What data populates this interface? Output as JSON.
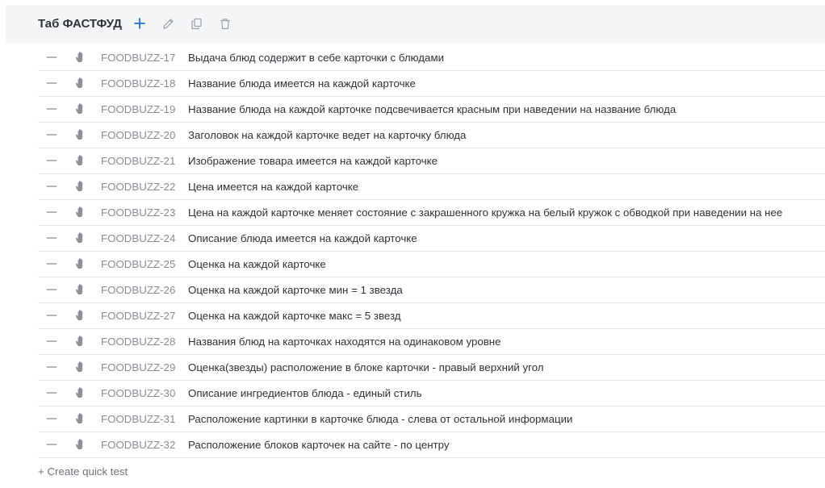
{
  "suite": {
    "title": "Таб ФАСТФУД",
    "actions": {
      "add": "plus-icon",
      "edit": "pencil-icon",
      "copy": "copy-icon",
      "delete": "trash-icon"
    }
  },
  "colors": {
    "accent": "#1d6fe0",
    "header_bg": "#f4f5f7",
    "icon_gray": "#9aa0a8",
    "row_border": "#e4e6ea"
  },
  "cases": [
    {
      "id": "FOODBUZZ-17",
      "title": "Выдача блюд содержит в себе карточки с блюдами"
    },
    {
      "id": "FOODBUZZ-18",
      "title": "Название блюда имеется на каждой карточке"
    },
    {
      "id": "FOODBUZZ-19",
      "title": "Название блюда на каждой карточке подсвечивается красным при наведении на название блюда"
    },
    {
      "id": "FOODBUZZ-20",
      "title": "Заголовок на каждой карточке ведет на карточку блюда"
    },
    {
      "id": "FOODBUZZ-21",
      "title": "Изображение товара имеется на каждой карточке"
    },
    {
      "id": "FOODBUZZ-22",
      "title": "Цена имеется на каждой карточке"
    },
    {
      "id": "FOODBUZZ-23",
      "title": "Цена на каждой карточке меняет состояние с закрашенного кружка на белый кружок с обводкой при наведении на нее"
    },
    {
      "id": "FOODBUZZ-24",
      "title": "Описание блюда имеется на каждой карточке"
    },
    {
      "id": "FOODBUZZ-25",
      "title": "Оценка на каждой карточке"
    },
    {
      "id": "FOODBUZZ-26",
      "title": "Оценка на каждой карточке мин = 1 звезда"
    },
    {
      "id": "FOODBUZZ-27",
      "title": "Оценка на каждой карточке макс = 5 звезд"
    },
    {
      "id": "FOODBUZZ-28",
      "title": "Названия блюд на карточках находятся на одинаковом уровне"
    },
    {
      "id": "FOODBUZZ-29",
      "title": "Оценка(звезды) расположение в блоке карточки - правый верхний угол"
    },
    {
      "id": "FOODBUZZ-30",
      "title": "Описание ингредиентов блюда - единый стиль"
    },
    {
      "id": "FOODBUZZ-31",
      "title": "Расположение картинки в карточке блюда - слева от остальной информации"
    },
    {
      "id": "FOODBUZZ-32",
      "title": "Расположение блоков карточек на сайте - по центру"
    }
  ],
  "row_icons": {
    "priority": "priority-dash-icon",
    "type": "manual-hand-icon"
  },
  "quick_create_label": "+ Create quick test"
}
